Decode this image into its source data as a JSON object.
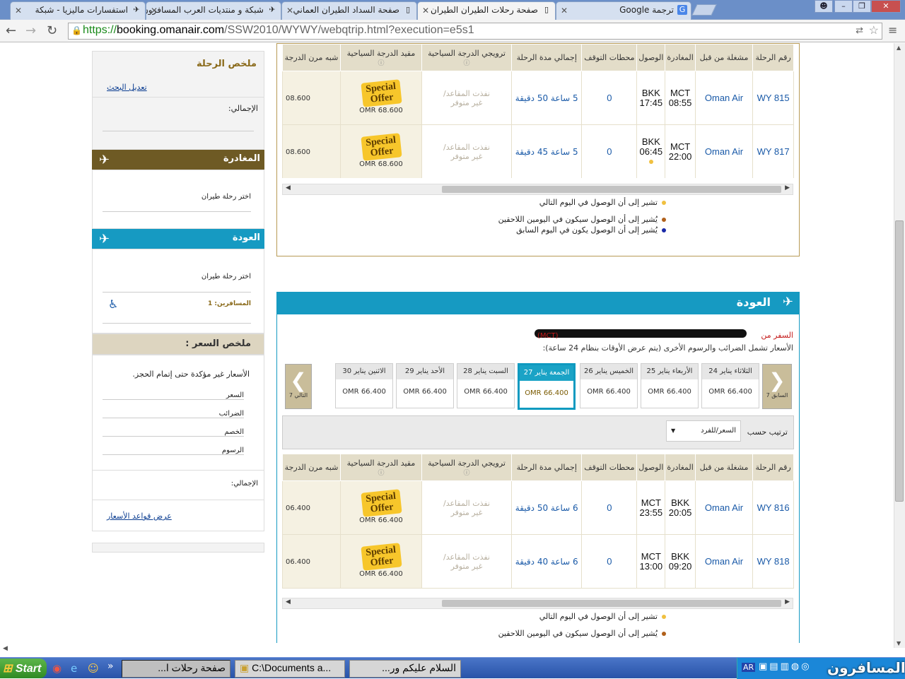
{
  "browser": {
    "tabs": [
      {
        "title": "استفسارات ماليزيا - شبكة",
        "icon": "plane-icon"
      },
      {
        "title": "شبكة و منتديات العرب المسافرون",
        "icon": "plane-icon"
      },
      {
        "title": "صفحة السداد الطيران العماني",
        "icon": "page-icon"
      },
      {
        "title": "صفحة رحلات الطيران الطيران",
        "icon": "page-icon"
      },
      {
        "title": "ترجمة Google",
        "icon": "google-translate-icon"
      }
    ],
    "url_scheme": "https://",
    "url_domain": "booking.omanair.com",
    "url_path": "/SSW2010/WYWY/webqtrip.html?execution=e5s1"
  },
  "sidebar": {
    "summary_title": "ملخص الرحلة",
    "modify_search": "تعديل البحث",
    "total_label": "الإجمالي:",
    "departure_title": "المغادرة",
    "departure_choose": "اختر رحلة طيران",
    "return_title": "العودة",
    "return_choose": "اختر رحلة طيران",
    "passengers": "المسافرين: 1",
    "price_summary_title": "ملخص السعر :",
    "price_note": "الأسعار غير مؤكدة حتى إتمام الحجز.",
    "rows": [
      "السعر",
      "الضرائب",
      "الخصم",
      "الرسوم"
    ],
    "total_label2": "الإجمالي:",
    "fare_rules": "عرض قواعد الأسعار"
  },
  "columns": [
    "رقم الرحلة",
    "مشغلة من قبل",
    "المغادرة",
    "الوصول",
    "محطات التوقف",
    "إجمالي مدة الرحلة",
    "ترويجي الدرجة السياحية",
    "مقيد الدرجة السياحية",
    "شبه مرن الدرجة"
  ],
  "special_line1": "Special",
  "special_line2": "Offer",
  "sold_out1": "نفذت المقاعد/",
  "sold_out2": "غير متوفر",
  "outbound": [
    {
      "flight": "WY 815",
      "carrier": "Oman Air",
      "dep_apt": "MCT",
      "dep_time": "08:55",
      "arr_apt": "BKK",
      "arr_time": "17:45",
      "stops": "0",
      "duration": "5 ساعة 50 دقيقة",
      "price": "OMR 68.600",
      "price_cut": "08.600"
    },
    {
      "flight": "WY 817",
      "carrier": "Oman Air",
      "dep_apt": "MCT",
      "dep_time": "22:00",
      "arr_apt": "BKK",
      "arr_time": "06:45",
      "stops": "0",
      "duration": "5 ساعة 45 دقيقة",
      "price": "OMR 68.600",
      "price_cut": "08.600"
    }
  ],
  "legend": [
    {
      "text": "تشير إلى أن الوصول في اليوم التالي",
      "color": "#f0c040"
    },
    {
      "text": "يُشير إلى أن الوصول سيكون في اليومين اللاحقين",
      "color": "#b0601a"
    },
    {
      "text": "يُشير إلى أن الوصول يكون في اليوم السابق",
      "color": "#1a2aa8"
    }
  ],
  "return": {
    "title": "العودة",
    "travel_from": "السفر من",
    "airport_code": "(MCT)",
    "note": "الأسعار تشمل الضرائب والرسوم الأخرى (يتم عرض الأوقات بنظام 24 ساعة):",
    "prev": "السابق 7",
    "next": "التالي 7",
    "sort_label": "ترتيب حسب",
    "sort_value": "السعر/للفرد",
    "days": [
      {
        "label": "الثلاثاء يناير 24",
        "price": "OMR 66.400",
        "selected": false
      },
      {
        "label": "الأربعاء يناير 25",
        "price": "OMR 66.400",
        "selected": false
      },
      {
        "label": "الخميس يناير 26",
        "price": "OMR 66.400",
        "selected": false
      },
      {
        "label": "الجمعة يناير 27",
        "price": "OMR 66.400",
        "selected": true
      },
      {
        "label": "السبت يناير 28",
        "price": "OMR 66.400",
        "selected": false
      },
      {
        "label": "الأحد يناير 29",
        "price": "OMR 66.400",
        "selected": false
      },
      {
        "label": "الاثنين يناير 30",
        "price": "OMR 66.400",
        "selected": false
      }
    ],
    "flights": [
      {
        "flight": "WY 816",
        "carrier": "Oman Air",
        "dep_apt": "BKK",
        "dep_time": "20:05",
        "arr_apt": "MCT",
        "arr_time": "23:55",
        "stops": "0",
        "duration": "6 ساعة 50 دقيقة",
        "price": "OMR 66.400",
        "price_cut": "06.400"
      },
      {
        "flight": "WY 818",
        "carrier": "Oman Air",
        "dep_apt": "BKK",
        "dep_time": "09:20",
        "arr_apt": "MCT",
        "arr_time": "13:00",
        "stops": "0",
        "duration": "6 ساعة 40 دقيقة",
        "price": "OMR 66.400",
        "price_cut": "06.400"
      }
    ]
  },
  "taskbar": {
    "start": "Start",
    "items": [
      "صفحة رحلات ا...",
      "C:\\Documents a...",
      "السلام عليكم ور..."
    ],
    "lang": "AR",
    "watermark": "المسافرون"
  }
}
